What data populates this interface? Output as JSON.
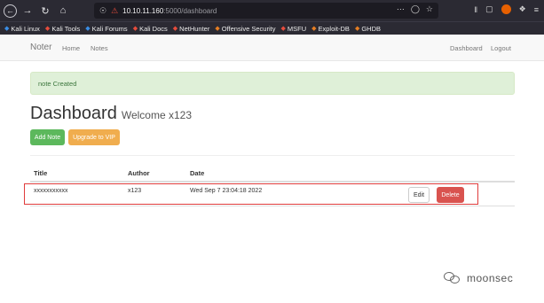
{
  "browser": {
    "url_host": "10.10.11.160",
    "url_path": ":5000/dashboard",
    "bookmarks": [
      {
        "label": "Kali Linux",
        "color": "#3a8ee6"
      },
      {
        "label": "Kali Tools",
        "color": "#e74c3c"
      },
      {
        "label": "Kali Forums",
        "color": "#3a8ee6"
      },
      {
        "label": "Kali Docs",
        "color": "#e74c3c"
      },
      {
        "label": "NetHunter",
        "color": "#e74c3c"
      },
      {
        "label": "Offensive Security",
        "color": "#e67e22"
      },
      {
        "label": "MSFU",
        "color": "#e74c3c"
      },
      {
        "label": "Exploit-DB",
        "color": "#e67e22"
      },
      {
        "label": "GHDB",
        "color": "#e67e22"
      }
    ]
  },
  "navbar": {
    "brand": "Noter",
    "links": [
      "Home",
      "Notes"
    ],
    "right_links": [
      "Dashboard",
      "Logout"
    ]
  },
  "alert": {
    "text": "note Created"
  },
  "dashboard": {
    "title": "Dashboard",
    "welcome": "Welcome x123",
    "add_note_label": "Add Note",
    "upgrade_label": "Upgrade to VIP"
  },
  "table": {
    "headers": [
      "Title",
      "Author",
      "Date"
    ],
    "rows": [
      {
        "title": "xxxxxxxxxxx",
        "author": "x123",
        "date": "Wed Sep 7 23:04:18 2022"
      }
    ],
    "edit_label": "Edit",
    "delete_label": "Delete"
  },
  "watermark": {
    "text": "moonsec"
  },
  "colors": {
    "success": "#5cb85c",
    "warning": "#f0ad4e",
    "danger": "#d9534f",
    "highlight": "#e03c3c"
  }
}
